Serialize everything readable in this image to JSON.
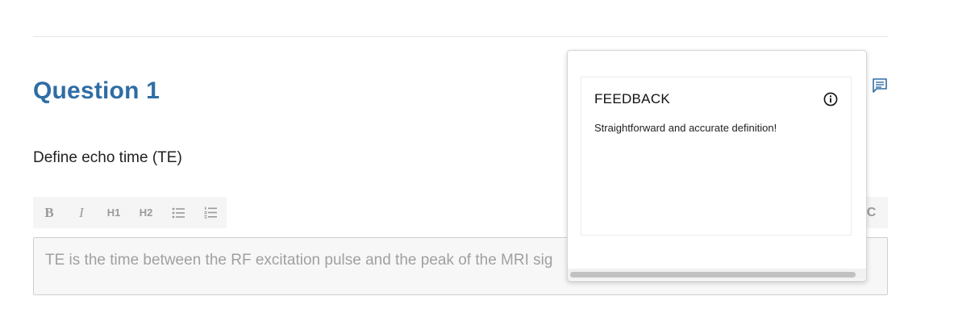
{
  "question": {
    "title": "Question 1",
    "prompt": "Define echo time (TE)"
  },
  "toolbar": {
    "bold": "B",
    "italic": "I",
    "h1": "H1",
    "h2": "H2",
    "bullet_list_icon": "bullet-list-icon",
    "numbered_list_icon": "numbered-list-icon",
    "right_partial": "C"
  },
  "answer": {
    "text": "TE is the time between the RF excitation pulse and the peak of the MRI sig"
  },
  "feedback_popover": {
    "heading": "FEEDBACK",
    "body": "Straightforward and accurate definition!",
    "info_icon": "info-icon"
  },
  "icons": {
    "comment": "comment-icon"
  },
  "colors": {
    "accent": "#2f6da4",
    "toolbar_bg": "#f5f5f5",
    "answer_bg": "#f7f7f7"
  }
}
